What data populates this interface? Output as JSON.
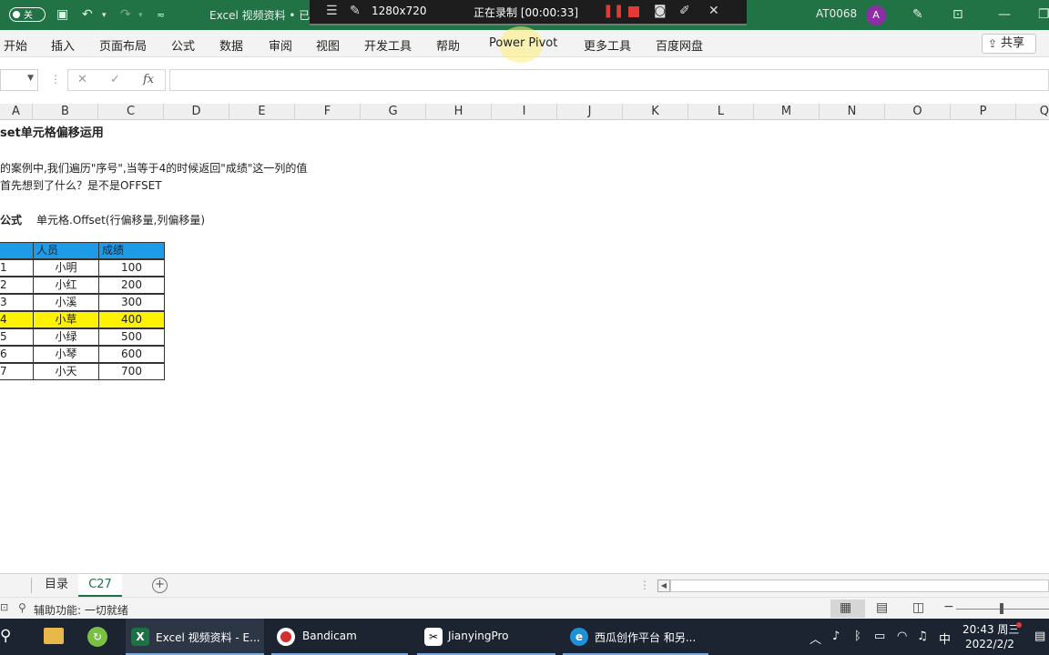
{
  "titlebar": {
    "autosave_label": "关",
    "app_title": "Excel 视频资料 • 已保",
    "user": "AT0068",
    "avatar_letter": "A"
  },
  "recorder": {
    "resolution": "1280x720",
    "status": "正在录制 [00:00:33]"
  },
  "ribbon": {
    "tabs": [
      "开始",
      "插入",
      "页面布局",
      "公式",
      "数据",
      "审阅",
      "视图",
      "开发工具",
      "帮助",
      "Power Pivot",
      "更多工具",
      "百度网盘"
    ],
    "share_label": "共享"
  },
  "formula_bar": {
    "fx_label": "fx",
    "value": ""
  },
  "columns": [
    "A",
    "B",
    "C",
    "D",
    "E",
    "F",
    "G",
    "H",
    "I",
    "J",
    "K",
    "L",
    "M",
    "N",
    "O",
    "P",
    "Q"
  ],
  "sheet": {
    "title": "set单元格偏移运用",
    "desc1": "的案例中,我们遍历\"序号\",当等于4的时候返回\"成绩\"这一列的值",
    "desc2": "首先想到了什么？是不是OFFSET",
    "formula_label": "公式",
    "formula_text": "单元格.Offset(行偏移量,列偏移量)",
    "table": {
      "headers": [
        "",
        "人员",
        "成绩"
      ],
      "rows": [
        [
          "1",
          "小明",
          "100"
        ],
        [
          "2",
          "小红",
          "200"
        ],
        [
          "3",
          "小溪",
          "300"
        ],
        [
          "4",
          "小草",
          "400"
        ],
        [
          "5",
          "小绿",
          "500"
        ],
        [
          "6",
          "小琴",
          "600"
        ],
        [
          "7",
          "小天",
          "700"
        ]
      ],
      "highlight_row_index": 3,
      "header_color": "#1e9be6",
      "highlight_color": "#fff200"
    }
  },
  "sheet_tabs": {
    "tabs": [
      "目录",
      "C27"
    ],
    "active": "C27"
  },
  "statusbar": {
    "text": "辅助功能: 一切就绪"
  },
  "taskbar": {
    "apps": [
      "Excel 视频资料 - E...",
      "Bandicam",
      "JianyingPro",
      "西瓜创作平台 和另..."
    ],
    "ime": "中",
    "time": "20:43 周三",
    "date": "2022/2/2"
  }
}
